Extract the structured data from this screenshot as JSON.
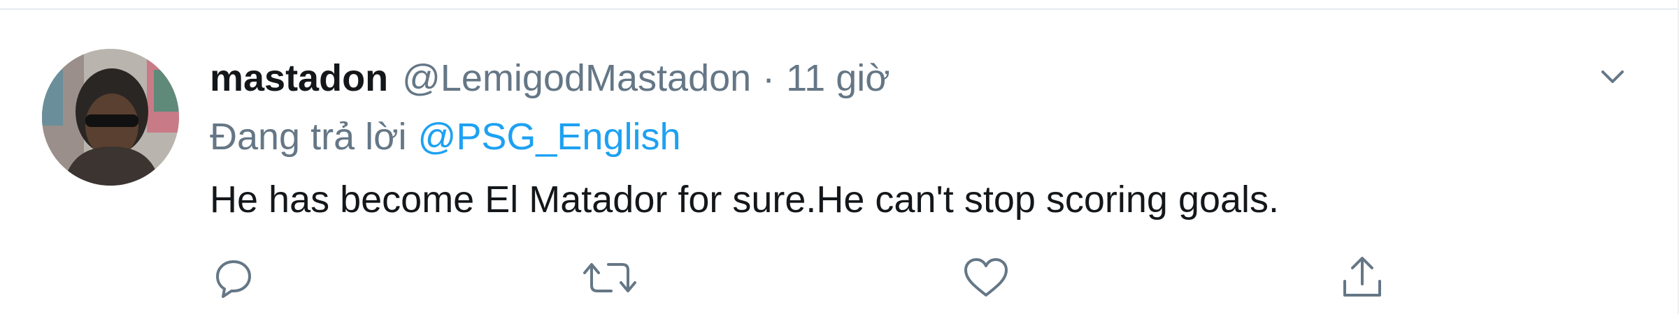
{
  "tweet": {
    "display_name": "mastadon",
    "handle": "@LemigodMastadon",
    "separator": "·",
    "time": "11 giờ",
    "reply_prefix": "Đang trả lời",
    "reply_to": "@PSG_English",
    "text": "He has become El Matador for sure.He can't stop scoring goals."
  },
  "icons": {
    "caret": "chevron-down-icon",
    "reply": "reply-icon",
    "retweet": "retweet-icon",
    "like": "heart-icon",
    "share": "share-icon"
  },
  "colors": {
    "primary_text": "#14171a",
    "secondary_text": "#657786",
    "link": "#1da1f2",
    "divider": "#e6ecf0"
  }
}
